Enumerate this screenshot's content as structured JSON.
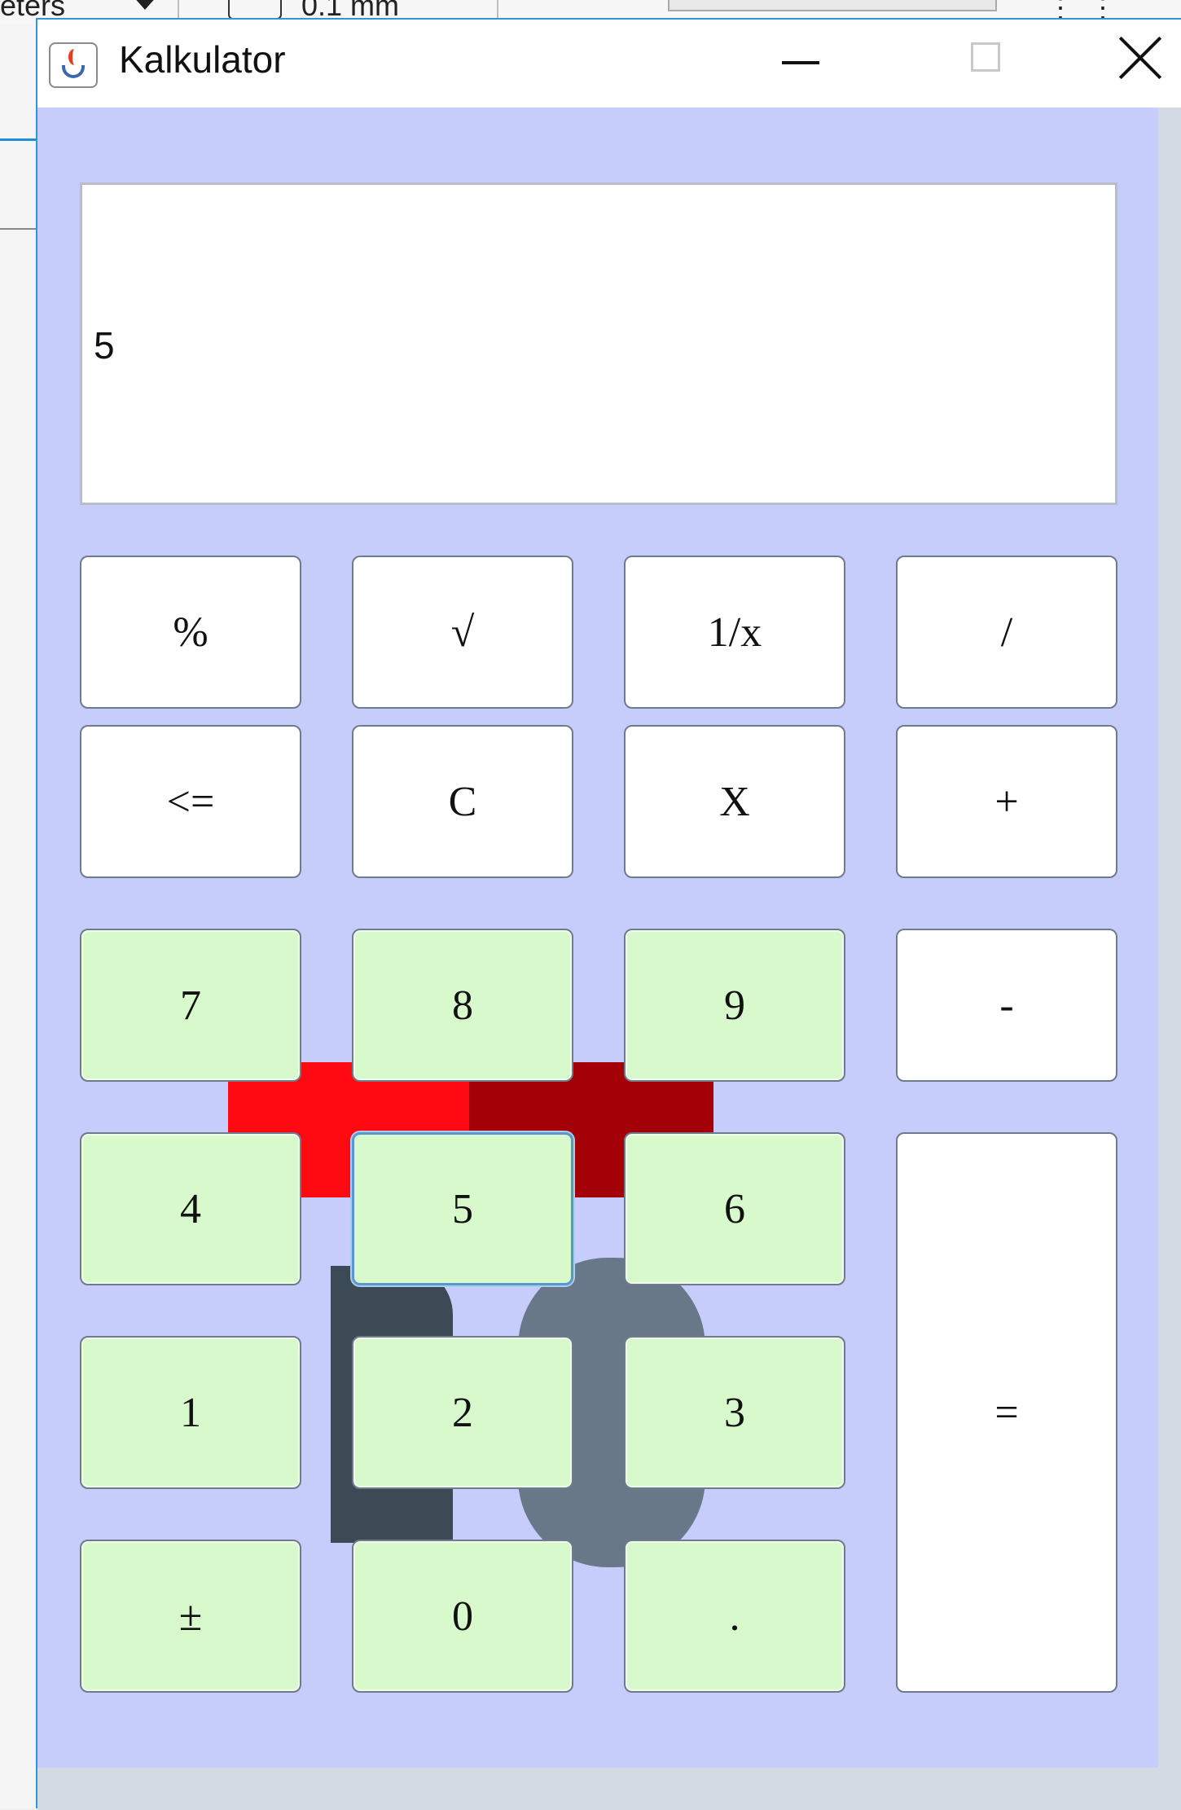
{
  "background_app": {
    "toolbar_left_text": "eters",
    "toolbar_value_text": "0.1 mm"
  },
  "window": {
    "title": "Kalkulator",
    "title_icon": "java-cup-icon"
  },
  "display": {
    "value": "5"
  },
  "buttons": {
    "percent": "%",
    "sqrt": "√",
    "reciprocal": "1/x",
    "divide": "/",
    "backspace": "<=",
    "clear": "C",
    "multiply": "X",
    "plus": "+",
    "seven": "7",
    "eight": "8",
    "nine": "9",
    "minus": "-",
    "four": "4",
    "five": "5",
    "six": "6",
    "equals": "=",
    "one": "1",
    "two": "2",
    "three": "3",
    "plus_minus": "±",
    "zero": "0",
    "decimal": "."
  },
  "colors": {
    "window_bg": "#c7cdfb",
    "digit_button_bg": "#d8f9cc",
    "operator_button_bg": "#ffffff",
    "focus_border": "#5b96cf"
  }
}
